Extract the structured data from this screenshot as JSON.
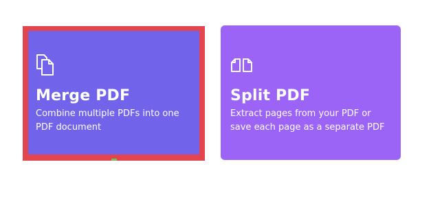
{
  "tools": [
    {
      "id": "merge",
      "title": "Merge PDF",
      "description_lines": [
        "Combine multiple PDFs into one",
        "PDF document"
      ],
      "icon": "merge-pages-icon",
      "color": "#7163ea",
      "selected": true
    },
    {
      "id": "split",
      "title": "Split PDF",
      "description_lines": [
        "Extract pages from your PDF or",
        "save each page as a separate PDF"
      ],
      "icon": "split-pages-icon",
      "color": "#9b63f6",
      "selected": false
    }
  ],
  "highlight_color": "#e3454f"
}
